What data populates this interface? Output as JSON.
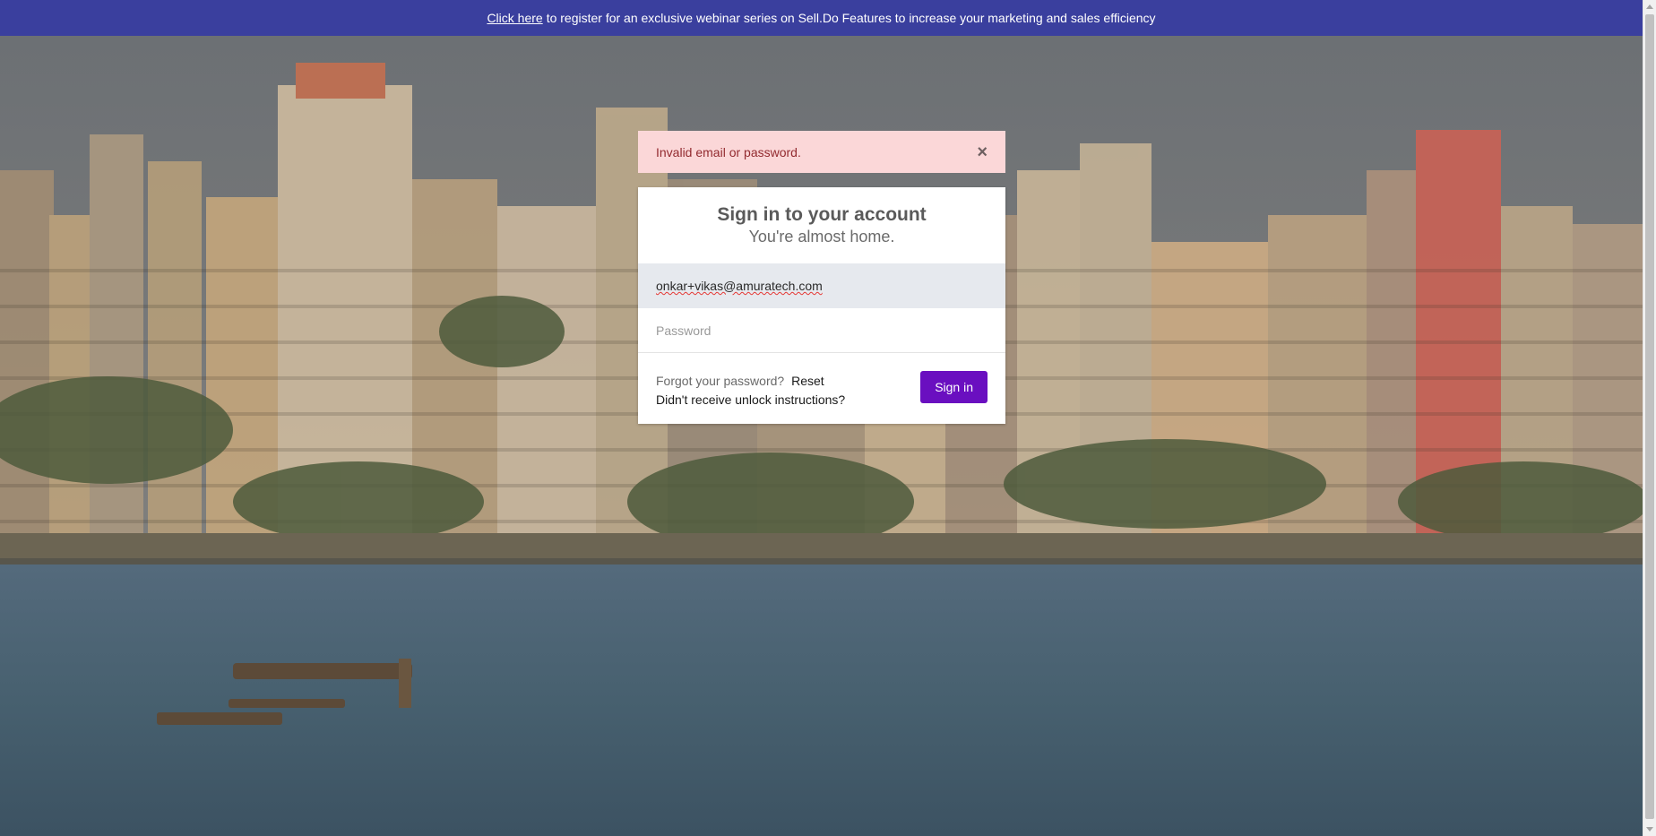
{
  "banner": {
    "link_text": "Click here",
    "message": "to register for an exclusive webinar series on Sell.Do Features to increase your marketing and sales efficiency",
    "background": "#3a3f9e"
  },
  "alert": {
    "message": "Invalid email or password.",
    "close_symbol": "×",
    "background": "#fbd7d8",
    "text_color": "#922a2f"
  },
  "login": {
    "title": "Sign in to your account",
    "subtitle": "You're almost home.",
    "email_value": "onkar+vikas@amuratech.com",
    "password_placeholder": "Password",
    "forgot_text": "Forgot your password?",
    "reset_link": "Reset",
    "unlock_link": "Didn't receive unlock instructions?",
    "signin_label": "Sign in",
    "accent": "#6a0fc0"
  }
}
